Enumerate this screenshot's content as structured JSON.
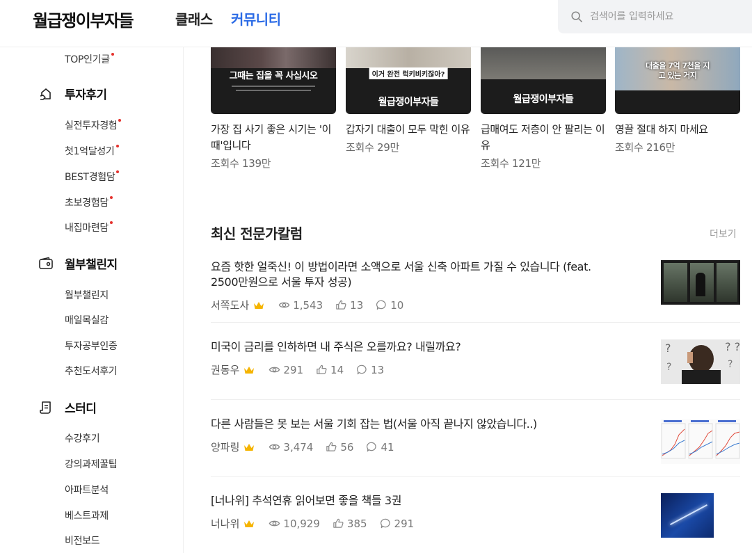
{
  "header": {
    "logo": "월급쟁이부자들",
    "nav_class": "클래스",
    "nav_community": "커뮤니티",
    "search_placeholder": "검색어를 입력하세요"
  },
  "sidebar": {
    "top_item": "TOP인기글",
    "sections": [
      {
        "title": "투자후기",
        "icon": "house-hand-icon",
        "items": [
          "실전투자경험",
          "첫1억달성기",
          "BEST경험담",
          "초보경험담",
          "내집마련담"
        ]
      },
      {
        "title": "월부챌린지",
        "icon": "wallet-icon",
        "items": [
          "월부챌린지",
          "매일목실감",
          "투자공부인증",
          "추천도서후기"
        ]
      },
      {
        "title": "스터디",
        "icon": "document-icon",
        "items": [
          "수강후기",
          "강의과제꿀팁",
          "아파트분석",
          "베스트과제",
          "비전보드"
        ]
      }
    ]
  },
  "videos": [
    {
      "caption": "그때는 집을 꼭 사십시오",
      "title": "가장 집 사기 좋은 시기는 '이때'입니다",
      "views": "조회수 139만"
    },
    {
      "caption_box": "이거 완전 럭키비키잖아?",
      "caption": "월급쟁이부자들",
      "title": "갑자기 대출이 모두 막힌 이유",
      "views": "조회수 29만"
    },
    {
      "caption": "월급쟁이부자들",
      "title": "급매여도 저층이 안 팔리는 이유",
      "views": "조회수 121만"
    },
    {
      "caption": "대출을 7억 7천을 지고 있는 거지",
      "title": "영끌 절대 하지 마세요",
      "views": "조회수 216만"
    }
  ],
  "columns": {
    "title": "최신 전문가칼럼",
    "more": "더보기",
    "posts": [
      {
        "title": "요즘 핫한 얼죽신! 이 방법이라면 소액으로 서울 신축 아파트 가질 수 있습니다 (feat. 2500만원으로 서울 투자 성공)",
        "author": "서쪽도사",
        "views": "1,543",
        "likes": "13",
        "comments": "10"
      },
      {
        "title": "미국이 금리를 인하하면 내 주식은 오를까요? 내릴까요?",
        "author": "권동우",
        "views": "291",
        "likes": "14",
        "comments": "13"
      },
      {
        "title": "다른 사람들은 못 보는 서울 기회 잡는 법(서울 아직 끝나지 않았습니다..)",
        "author": "양파링",
        "views": "3,474",
        "likes": "56",
        "comments": "41"
      },
      {
        "title": "[너나위] 추석연휴 읽어보면 좋을 책들 3권",
        "author": "너나위",
        "views": "10,929",
        "likes": "385",
        "comments": "291"
      }
    ]
  },
  "colors": {
    "accent": "#2b6be6",
    "new_dot": "#e5322d",
    "crown": "#f5b400"
  }
}
